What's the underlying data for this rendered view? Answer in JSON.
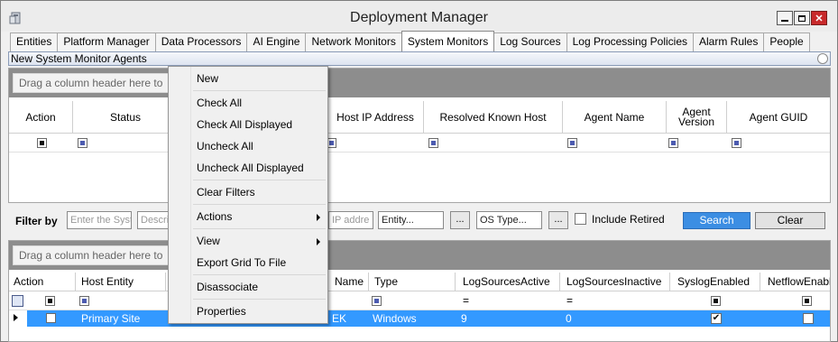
{
  "window": {
    "title": "Deployment Manager"
  },
  "tabs": [
    {
      "label": "Entities"
    },
    {
      "label": "Platform Manager"
    },
    {
      "label": "Data Processors"
    },
    {
      "label": "AI Engine"
    },
    {
      "label": "Network Monitors"
    },
    {
      "label": "System Monitors",
      "active": true
    },
    {
      "label": "Log Sources"
    },
    {
      "label": "Log Processing Policies"
    },
    {
      "label": "Alarm Rules"
    },
    {
      "label": "People"
    }
  ],
  "panel": {
    "title": "New System Monitor Agents"
  },
  "grid1": {
    "groupby_text": "Drag a column header here to",
    "columns": [
      "Action",
      "Status",
      "Host IP Address",
      "Resolved Known Host",
      "Agent Name",
      "Agent Version",
      "Agent GUID"
    ]
  },
  "filter": {
    "label": "Filter by",
    "placeholder_system": "Enter the Syst",
    "placeholder_desc": "Descri",
    "placeholder_ip": "IP addre",
    "entity_value": "Entity...",
    "ostype_value": "OS Type...",
    "dots_label": "...",
    "include_retired_label": "Include Retired",
    "search_label": "Search",
    "clear_label": "Clear"
  },
  "grid2": {
    "groupby_text": "Drag a column header here to",
    "columns": [
      "Action",
      "Host Entity",
      "Name",
      "Type",
      "LogSourcesActive",
      "LogSourcesInactive",
      "SyslogEnabled",
      "NetflowEnable"
    ],
    "eq_symbol": "=",
    "row": {
      "host_entity": "Primary Site",
      "name": "EK",
      "type": "Windows",
      "active": "9",
      "inactive": "0",
      "syslog": true,
      "netflow": false
    }
  },
  "context_menu": {
    "items": [
      "New",
      "Check All",
      "Check All Displayed",
      "Uncheck All",
      "Uncheck All Displayed",
      "Clear Filters",
      "Actions",
      "View",
      "Export Grid To File",
      "Disassociate",
      "Properties"
    ]
  },
  "colors": {
    "selection": "#3399ff",
    "search_button": "#3c8ee3",
    "groupby_bar": "#8d8d8d"
  }
}
